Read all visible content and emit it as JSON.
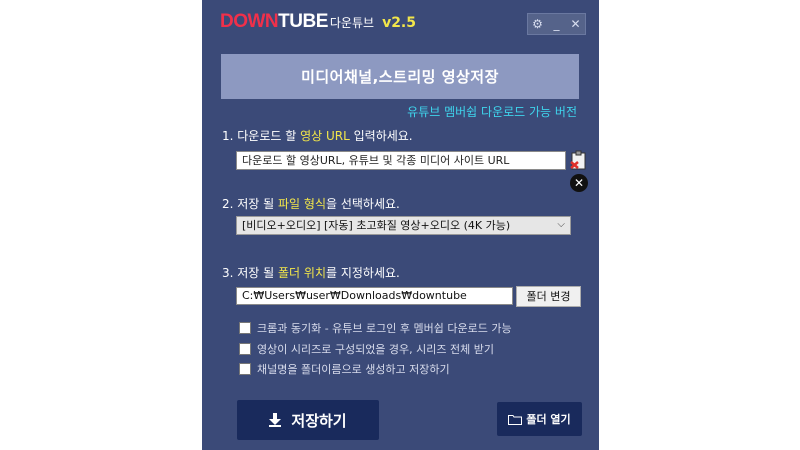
{
  "brand": {
    "down": "DOWN",
    "tube": "TUBE",
    "korean": "다운튜브",
    "version": "v2.5"
  },
  "controls": {
    "settings": "⚙",
    "minimize": "_",
    "close": "✕"
  },
  "banner": "미디어채널,스트리밍 영상저장",
  "member_notice": "유튜브 멤버쉽 다운로드 가능 버전",
  "step1": {
    "prefix": "1. 다운로드 할 ",
    "highlight": "영상 URL",
    "suffix": " 입력하세요."
  },
  "url_input": {
    "placeholder": "다운로드 할 영상URL, 유튜브 및 각종 미디어 사이트 URL"
  },
  "step2": {
    "prefix": "2. 저장 될 ",
    "highlight": "파일 형식",
    "suffix": "을 선택하세요."
  },
  "format_select": {
    "value": "[비디오+오디오] [자동] 초고화질 영상+오디오 (4K 가능)"
  },
  "step3": {
    "prefix": "3. 저장 될 ",
    "highlight": "폴더 위치",
    "suffix": "를 지정하세요."
  },
  "folder_path": "C:₩Users₩user₩Downloads₩downtube",
  "folder_change_button": "폴더 변경",
  "options": [
    "크롬과 동기화 - 유튜브 로그인 후 멤버쉽 다운로드 가능",
    "영상이 시리즈로 구성되었을 경우, 시리즈 전체 받기",
    "채널명을 폴더이름으로 생성하고 저장하기"
  ],
  "save_button": "저장하기",
  "open_folder_button": "폴더 열기",
  "colors": {
    "window_bg": "#3b4a78",
    "accent_yellow": "#f2e64a",
    "cyan_notice": "#3fd4ec",
    "button_navy": "#192a5c"
  }
}
